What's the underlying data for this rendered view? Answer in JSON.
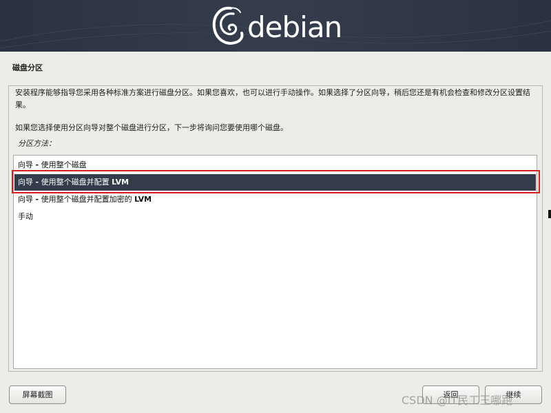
{
  "header": {
    "logo_text": "debian"
  },
  "page": {
    "title": "磁盘分区"
  },
  "description": {
    "line1": "安装程序能够指导您采用各种标准方案进行磁盘分区。如果您喜欢，也可以进行手动操作。如果选择了分区向导，稍后您还是有机会检查和修改分区设置结果。",
    "line2": "如果您选择使用分区向导对整个磁盘进行分区，下一步将询问您要使用哪个磁盘。"
  },
  "partition_method": {
    "label": "分区方法：",
    "options": [
      {
        "prefix": "向导 ",
        "dash": "-",
        "text": " 使用整个磁盘",
        "suffix": ""
      },
      {
        "prefix": "向导 ",
        "dash": "-",
        "text": " 使用整个磁盘并配置 ",
        "suffix": "LVM"
      },
      {
        "prefix": "向导 ",
        "dash": "-",
        "text": " 使用整个磁盘并配置加密的 ",
        "suffix": "LVM"
      },
      {
        "prefix": "手动",
        "dash": "",
        "text": "",
        "suffix": ""
      }
    ],
    "selected_index": 1
  },
  "buttons": {
    "screenshot": "屏幕截图",
    "back": "返回",
    "continue": "继续"
  },
  "watermark": "CSDN @IT民工王哪跑",
  "colors": {
    "header_bg": "#2a3240",
    "selection_bg": "#343c4b",
    "highlight_box": "#d82020",
    "page_bg": "#edece7"
  },
  "icons": {
    "logo": "debian-swirl-icon"
  }
}
